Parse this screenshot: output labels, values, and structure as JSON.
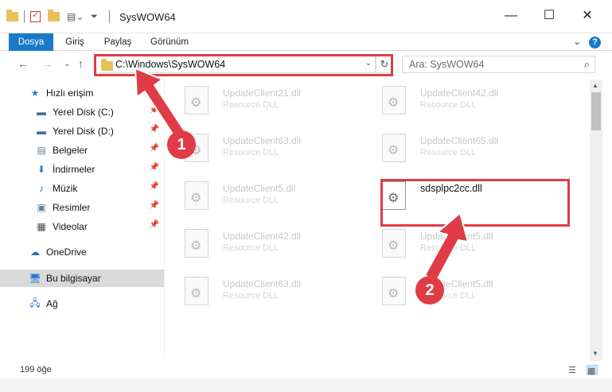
{
  "window": {
    "title": "SysWOW64",
    "minimize": "—",
    "maximize": "☐",
    "close": "✕"
  },
  "ribbon": {
    "tabs": [
      {
        "label": "Dosya",
        "active": true
      },
      {
        "label": "Giriş",
        "active": false
      },
      {
        "label": "Paylaş",
        "active": false
      },
      {
        "label": "Görünüm",
        "active": false
      }
    ],
    "expand": "⌄",
    "help": "?"
  },
  "nav": {
    "back": "←",
    "forward": "→",
    "recent": "⌄",
    "up": "↑",
    "address": "C:\\Windows\\SysWOW64",
    "refresh": "↻",
    "search_placeholder": "Ara: SysWOW64"
  },
  "sidebar": {
    "quick_access": "Hızlı erişim",
    "items": [
      {
        "label": "Yerel Disk (C:)",
        "icon": "drive-icon"
      },
      {
        "label": "Yerel Disk (D:)",
        "icon": "drive-icon"
      },
      {
        "label": "Belgeler",
        "icon": "documents-icon"
      },
      {
        "label": "İndirmeler",
        "icon": "downloads-icon"
      },
      {
        "label": "Müzik",
        "icon": "music-icon"
      },
      {
        "label": "Resimler",
        "icon": "pictures-icon"
      },
      {
        "label": "Videolar",
        "icon": "videos-icon"
      }
    ],
    "onedrive": "OneDrive",
    "this_pc": "Bu bilgisayar",
    "network": "Ağ"
  },
  "files": {
    "left": [
      {
        "name": "UpdateClient21.dll",
        "type": "Resource DLL"
      },
      {
        "name": "UpdateClient63.dll",
        "type": "Resource DLL"
      },
      {
        "name": "UpdateClient5.dll",
        "type": "Resource DLL"
      },
      {
        "name": "UpdateClient42.dll",
        "type": "Resource DLL"
      },
      {
        "name": "UpdateClient63.dll",
        "type": "Resource DLL"
      }
    ],
    "right": [
      {
        "name": "UpdateClient42.dll",
        "type": "Resource DLL"
      },
      {
        "name": "UpdateClient65.dll",
        "type": "Resource DLL"
      },
      {
        "name": "sdsplpc2cc.dll",
        "type": ""
      },
      {
        "name": "UpdateClient5.dll",
        "type": "Resource DLL"
      },
      {
        "name": "UpdateClient5.dll",
        "type": "Resource DLL"
      }
    ]
  },
  "status": {
    "item_count": "199 öğe"
  },
  "annotations": {
    "step1": "1",
    "step2": "2",
    "color": "#e03c46"
  }
}
